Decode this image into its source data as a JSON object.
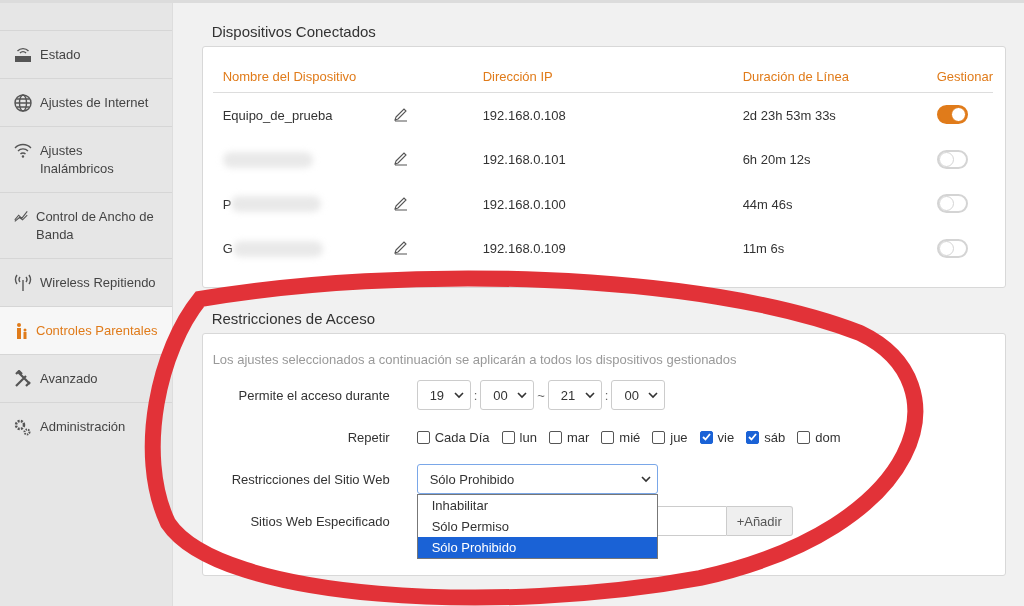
{
  "sidebar": {
    "items": [
      {
        "label": "Estado",
        "selected": false
      },
      {
        "label": "Ajustes de Internet",
        "selected": false
      },
      {
        "label": "Ajustes Inalámbricos",
        "selected": false
      },
      {
        "label": "Control de Ancho de Banda",
        "selected": false
      },
      {
        "label": "Wireless Repitiendo",
        "selected": false
      },
      {
        "label": "Controles Parentales",
        "selected": true
      },
      {
        "label": "Avanzado",
        "selected": false
      },
      {
        "label": "Administración",
        "selected": false
      }
    ]
  },
  "devices": {
    "title": "Dispositivos Conectados",
    "columns": [
      "Nombre del Dispositivo",
      "Dirección IP",
      "Duración de Línea",
      "Gestionar"
    ],
    "rows": [
      {
        "name": "Equipo_de_prueba",
        "redacted": false,
        "ip": "192.168.0.108",
        "duration": "2d 23h 53m 33s",
        "managed": true
      },
      {
        "redacted": true,
        "ip": "192.168.0.101",
        "duration": "6h 20m 12s",
        "managed": false
      },
      {
        "name": "P",
        "redacted": true,
        "ip": "192.168.0.100",
        "duration": "44m 46s",
        "managed": false
      },
      {
        "name": "G",
        "redacted": true,
        "ip": "192.168.0.109",
        "duration": "11m 6s",
        "managed": false
      }
    ]
  },
  "restrictions": {
    "title": "Restricciones de Acceso",
    "description": "Los ajustes seleccionados a continuación se aplicarán a todos los dispositivos gestionados",
    "time": {
      "label": "Permite el acceso durante",
      "start_hour": "19",
      "start_minute": "00",
      "separator_1": ":",
      "range": "~",
      "end_hour": "21",
      "end_minute": "00",
      "separator_2": ":"
    },
    "repeat": {
      "label": "Repetir",
      "days": [
        {
          "label": "Cada Día",
          "checked": false
        },
        {
          "label": "lun",
          "checked": false
        },
        {
          "label": "mar",
          "checked": false
        },
        {
          "label": "mié",
          "checked": false
        },
        {
          "label": "jue",
          "checked": false
        },
        {
          "label": "vie",
          "checked": true
        },
        {
          "label": "sáb",
          "checked": true
        },
        {
          "label": "dom",
          "checked": false
        }
      ]
    },
    "website": {
      "label": "Restricciones del Sitio Web",
      "value": "Sólo Prohibido",
      "open": true,
      "options": [
        {
          "label": "Inhabilitar",
          "selected": false
        },
        {
          "label": "Sólo Permiso",
          "selected": false
        },
        {
          "label": "Sólo Prohibido",
          "selected": true
        }
      ]
    },
    "specified": {
      "label": "Sitios Web Especificado",
      "button": "+Añadir"
    }
  }
}
